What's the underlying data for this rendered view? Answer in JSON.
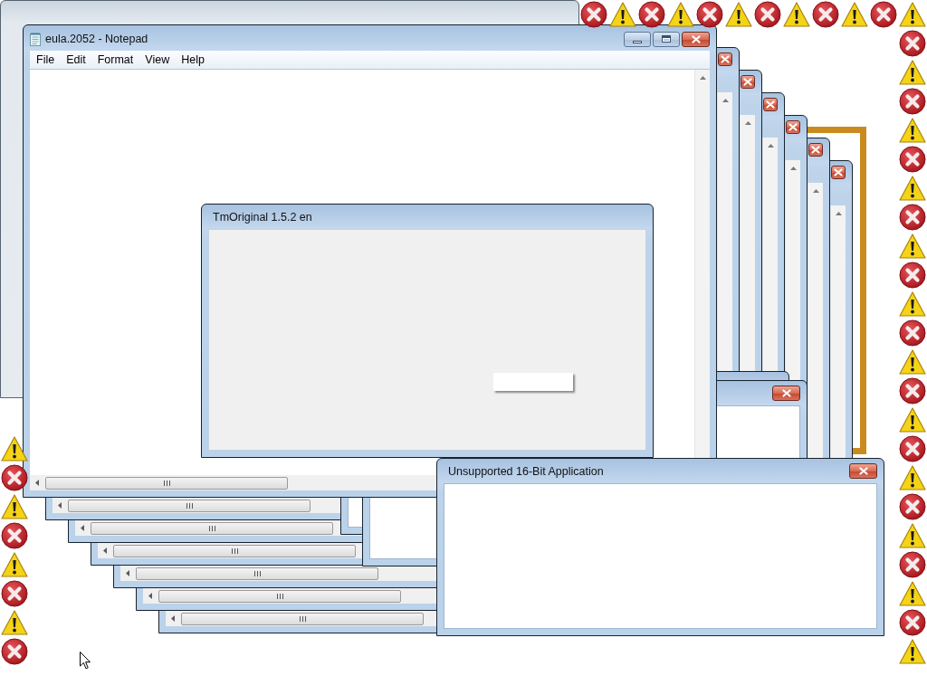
{
  "background_windows": [
    {
      "kind": "plain"
    },
    {
      "kind": "picture_frame"
    },
    {
      "kind": "notepad"
    },
    {
      "kind": "notepad"
    },
    {
      "kind": "notepad"
    },
    {
      "kind": "notepad"
    },
    {
      "kind": "notepad"
    },
    {
      "kind": "notepad"
    },
    {
      "kind": "dialog_edge"
    },
    {
      "kind": "dialog"
    }
  ],
  "notepad": {
    "title": "eula.2052 - Notepad",
    "menu": [
      "File",
      "Edit",
      "Format",
      "View",
      "Help"
    ]
  },
  "app_window": {
    "title": "TmOriginal 1.5.2 en",
    "buttons": [
      {
        "kind": "blank"
      }
    ]
  },
  "error_dialog": {
    "title": "Unsupported 16-Bit Application"
  },
  "alert_icons": {
    "top": [
      {
        "kind": "error"
      },
      {
        "kind": "warning"
      },
      {
        "kind": "error"
      },
      {
        "kind": "warning"
      },
      {
        "kind": "error"
      },
      {
        "kind": "warning"
      },
      {
        "kind": "error"
      },
      {
        "kind": "warning"
      },
      {
        "kind": "error"
      },
      {
        "kind": "warning"
      },
      {
        "kind": "error"
      },
      {
        "kind": "warning"
      }
    ],
    "right": [
      {
        "kind": "error"
      },
      {
        "kind": "warning"
      },
      {
        "kind": "error"
      },
      {
        "kind": "warning"
      },
      {
        "kind": "error"
      },
      {
        "kind": "warning"
      },
      {
        "kind": "error"
      },
      {
        "kind": "warning"
      },
      {
        "kind": "error"
      },
      {
        "kind": "warning"
      },
      {
        "kind": "error"
      },
      {
        "kind": "warning"
      },
      {
        "kind": "error"
      },
      {
        "kind": "warning"
      },
      {
        "kind": "error"
      },
      {
        "kind": "warning"
      },
      {
        "kind": "error"
      },
      {
        "kind": "warning"
      },
      {
        "kind": "error"
      },
      {
        "kind": "warning"
      },
      {
        "kind": "error"
      },
      {
        "kind": "warning"
      }
    ],
    "left": [
      {
        "kind": "warning"
      },
      {
        "kind": "error"
      },
      {
        "kind": "warning"
      },
      {
        "kind": "error"
      },
      {
        "kind": "warning"
      },
      {
        "kind": "error"
      },
      {
        "kind": "warning"
      },
      {
        "kind": "error"
      }
    ]
  }
}
